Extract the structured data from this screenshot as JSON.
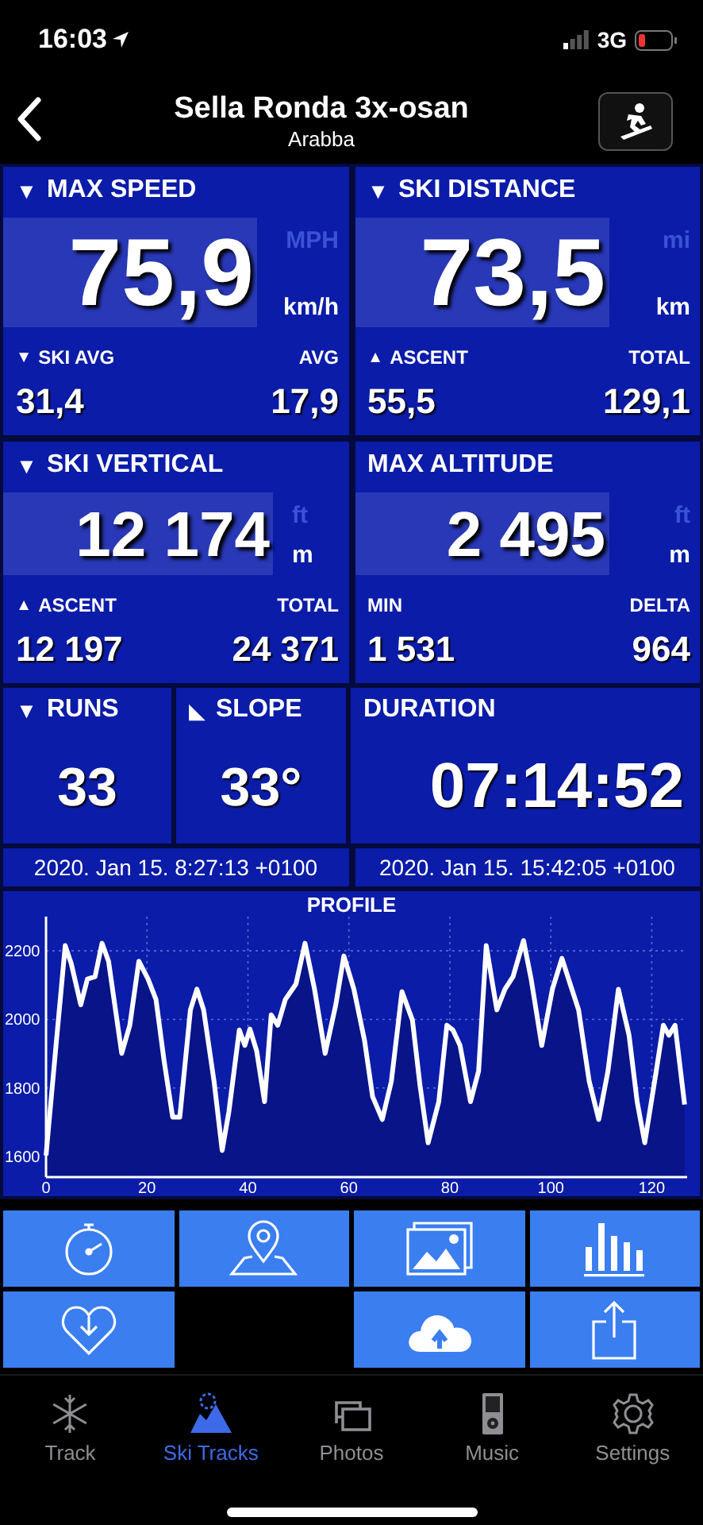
{
  "status_bar": {
    "time": "16:03",
    "network": "3G"
  },
  "nav": {
    "title": "Sella Ronda 3x-osan",
    "subtitle": "Arabba"
  },
  "stats": [
    {
      "title": "MAX SPEED",
      "marker": "▼",
      "value": "75,9",
      "unit_alt": "MPH",
      "unit": "km/h",
      "sub": [
        {
          "label": "SKI AVG",
          "marker": "▼",
          "value": "31,4"
        },
        {
          "label": "AVG",
          "value": "17,9"
        }
      ]
    },
    {
      "title": "SKI DISTANCE",
      "marker": "▼",
      "value": "73,5",
      "unit_alt": "mi",
      "unit": "km",
      "sub": [
        {
          "label": "ASCENT",
          "marker": "▲",
          "value": "55,5"
        },
        {
          "label": "TOTAL",
          "value": "129,1"
        }
      ]
    },
    {
      "title": "SKI VERTICAL",
      "marker": "▼",
      "value": "12 174",
      "unit_alt": "ft",
      "unit": "m",
      "sub": [
        {
          "label": "ASCENT",
          "marker": "▲",
          "value": "12 197"
        },
        {
          "label": "TOTAL",
          "value": "24 371"
        }
      ]
    },
    {
      "title": "MAX ALTITUDE",
      "value": "2 495",
      "unit_alt": "ft",
      "unit": "m",
      "sub": [
        {
          "label": "MIN",
          "value": "1 531"
        },
        {
          "label": "DELTA",
          "value": "964"
        }
      ]
    }
  ],
  "counters": [
    {
      "title": "RUNS",
      "marker": "▼",
      "value": "33"
    },
    {
      "title": "SLOPE",
      "marker": "◣",
      "value": "33°"
    },
    {
      "title": "DURATION",
      "value": "07:14:52"
    }
  ],
  "dates": [
    "2020. Jan 15. 8:27:13 +0100",
    "2020. Jan 15. 15:42:05 +0100"
  ],
  "profile": {
    "chart_data": {
      "type": "area",
      "title": "PROFILE",
      "grid": true,
      "x": [
        0,
        1.9,
        3.8,
        5,
        6.9,
        8.2,
        9.7,
        11.1,
        12.4,
        15,
        16.6,
        18.4,
        20.2,
        21.8,
        23.4,
        25.1,
        26.5,
        28.6,
        29.9,
        31.2,
        33.3,
        34.9,
        36.2,
        38.3,
        39.4,
        40.4,
        41.7,
        43.3,
        44.6,
        45.9,
        47.4,
        49.5,
        51.3,
        53.2,
        55.3,
        57.4,
        59,
        61,
        63.1,
        64.7,
        66.6,
        68.4,
        70.5,
        72.6,
        74.1,
        75.7,
        77.8,
        79.4,
        80.6,
        82,
        84.1,
        85.7,
        87.2,
        89.3,
        90.9,
        92.5,
        94.6,
        96.1,
        98.2,
        100.3,
        102.2,
        104,
        105.5,
        107.6,
        109.5,
        111.3,
        113.4,
        115.5,
        117.1,
        118.6,
        120.7,
        122.3,
        123.4,
        124.6,
        126.5
      ],
      "series": [
        {
          "color": "#ffffff",
          "values": [
            1603,
            1909,
            2215,
            2163,
            2043,
            2118,
            2125,
            2222,
            2170,
            1901,
            1983,
            2170,
            2118,
            2058,
            1879,
            1715,
            1715,
            2028,
            2088,
            2028,
            1819,
            1618,
            1730,
            1969,
            1924,
            1972,
            1909,
            1760,
            2013,
            1983,
            2058,
            2103,
            2222,
            2088,
            1901,
            2043,
            2185,
            2088,
            1939,
            1775,
            1708,
            1819,
            2081,
            1998,
            1806,
            1640,
            1760,
            1983,
            1969,
            1924,
            1760,
            1849,
            2215,
            2028,
            2088,
            2125,
            2230,
            2118,
            1924,
            2088,
            2178,
            2096,
            2028,
            1819,
            1708,
            1849,
            2088,
            1954,
            1760,
            1640,
            1834,
            1983,
            1954,
            1983,
            1752
          ]
        }
      ],
      "xlim": [
        0,
        127
      ],
      "ylim": [
        1540,
        2300
      ],
      "xticks": [
        0,
        20,
        40,
        60,
        80,
        100,
        120
      ],
      "yticks": [
        1600,
        1800,
        2000,
        2200
      ]
    }
  },
  "actions": [
    {
      "kind": "stopwatch"
    },
    {
      "kind": "map-pin"
    },
    {
      "kind": "photos"
    },
    {
      "kind": "bars"
    },
    {
      "kind": "heart"
    },
    {
      "kind": "gap"
    },
    {
      "kind": "cloud-upload"
    },
    {
      "kind": "share"
    }
  ],
  "tabs": [
    {
      "label": "Track",
      "kind": "snowflake",
      "selected": false
    },
    {
      "label": "Ski Tracks",
      "kind": "mountain",
      "selected": true
    },
    {
      "label": "Photos",
      "kind": "photos",
      "selected": false
    },
    {
      "label": "Music",
      "kind": "player",
      "selected": false
    },
    {
      "label": "Settings",
      "kind": "gear",
      "selected": false
    }
  ]
}
